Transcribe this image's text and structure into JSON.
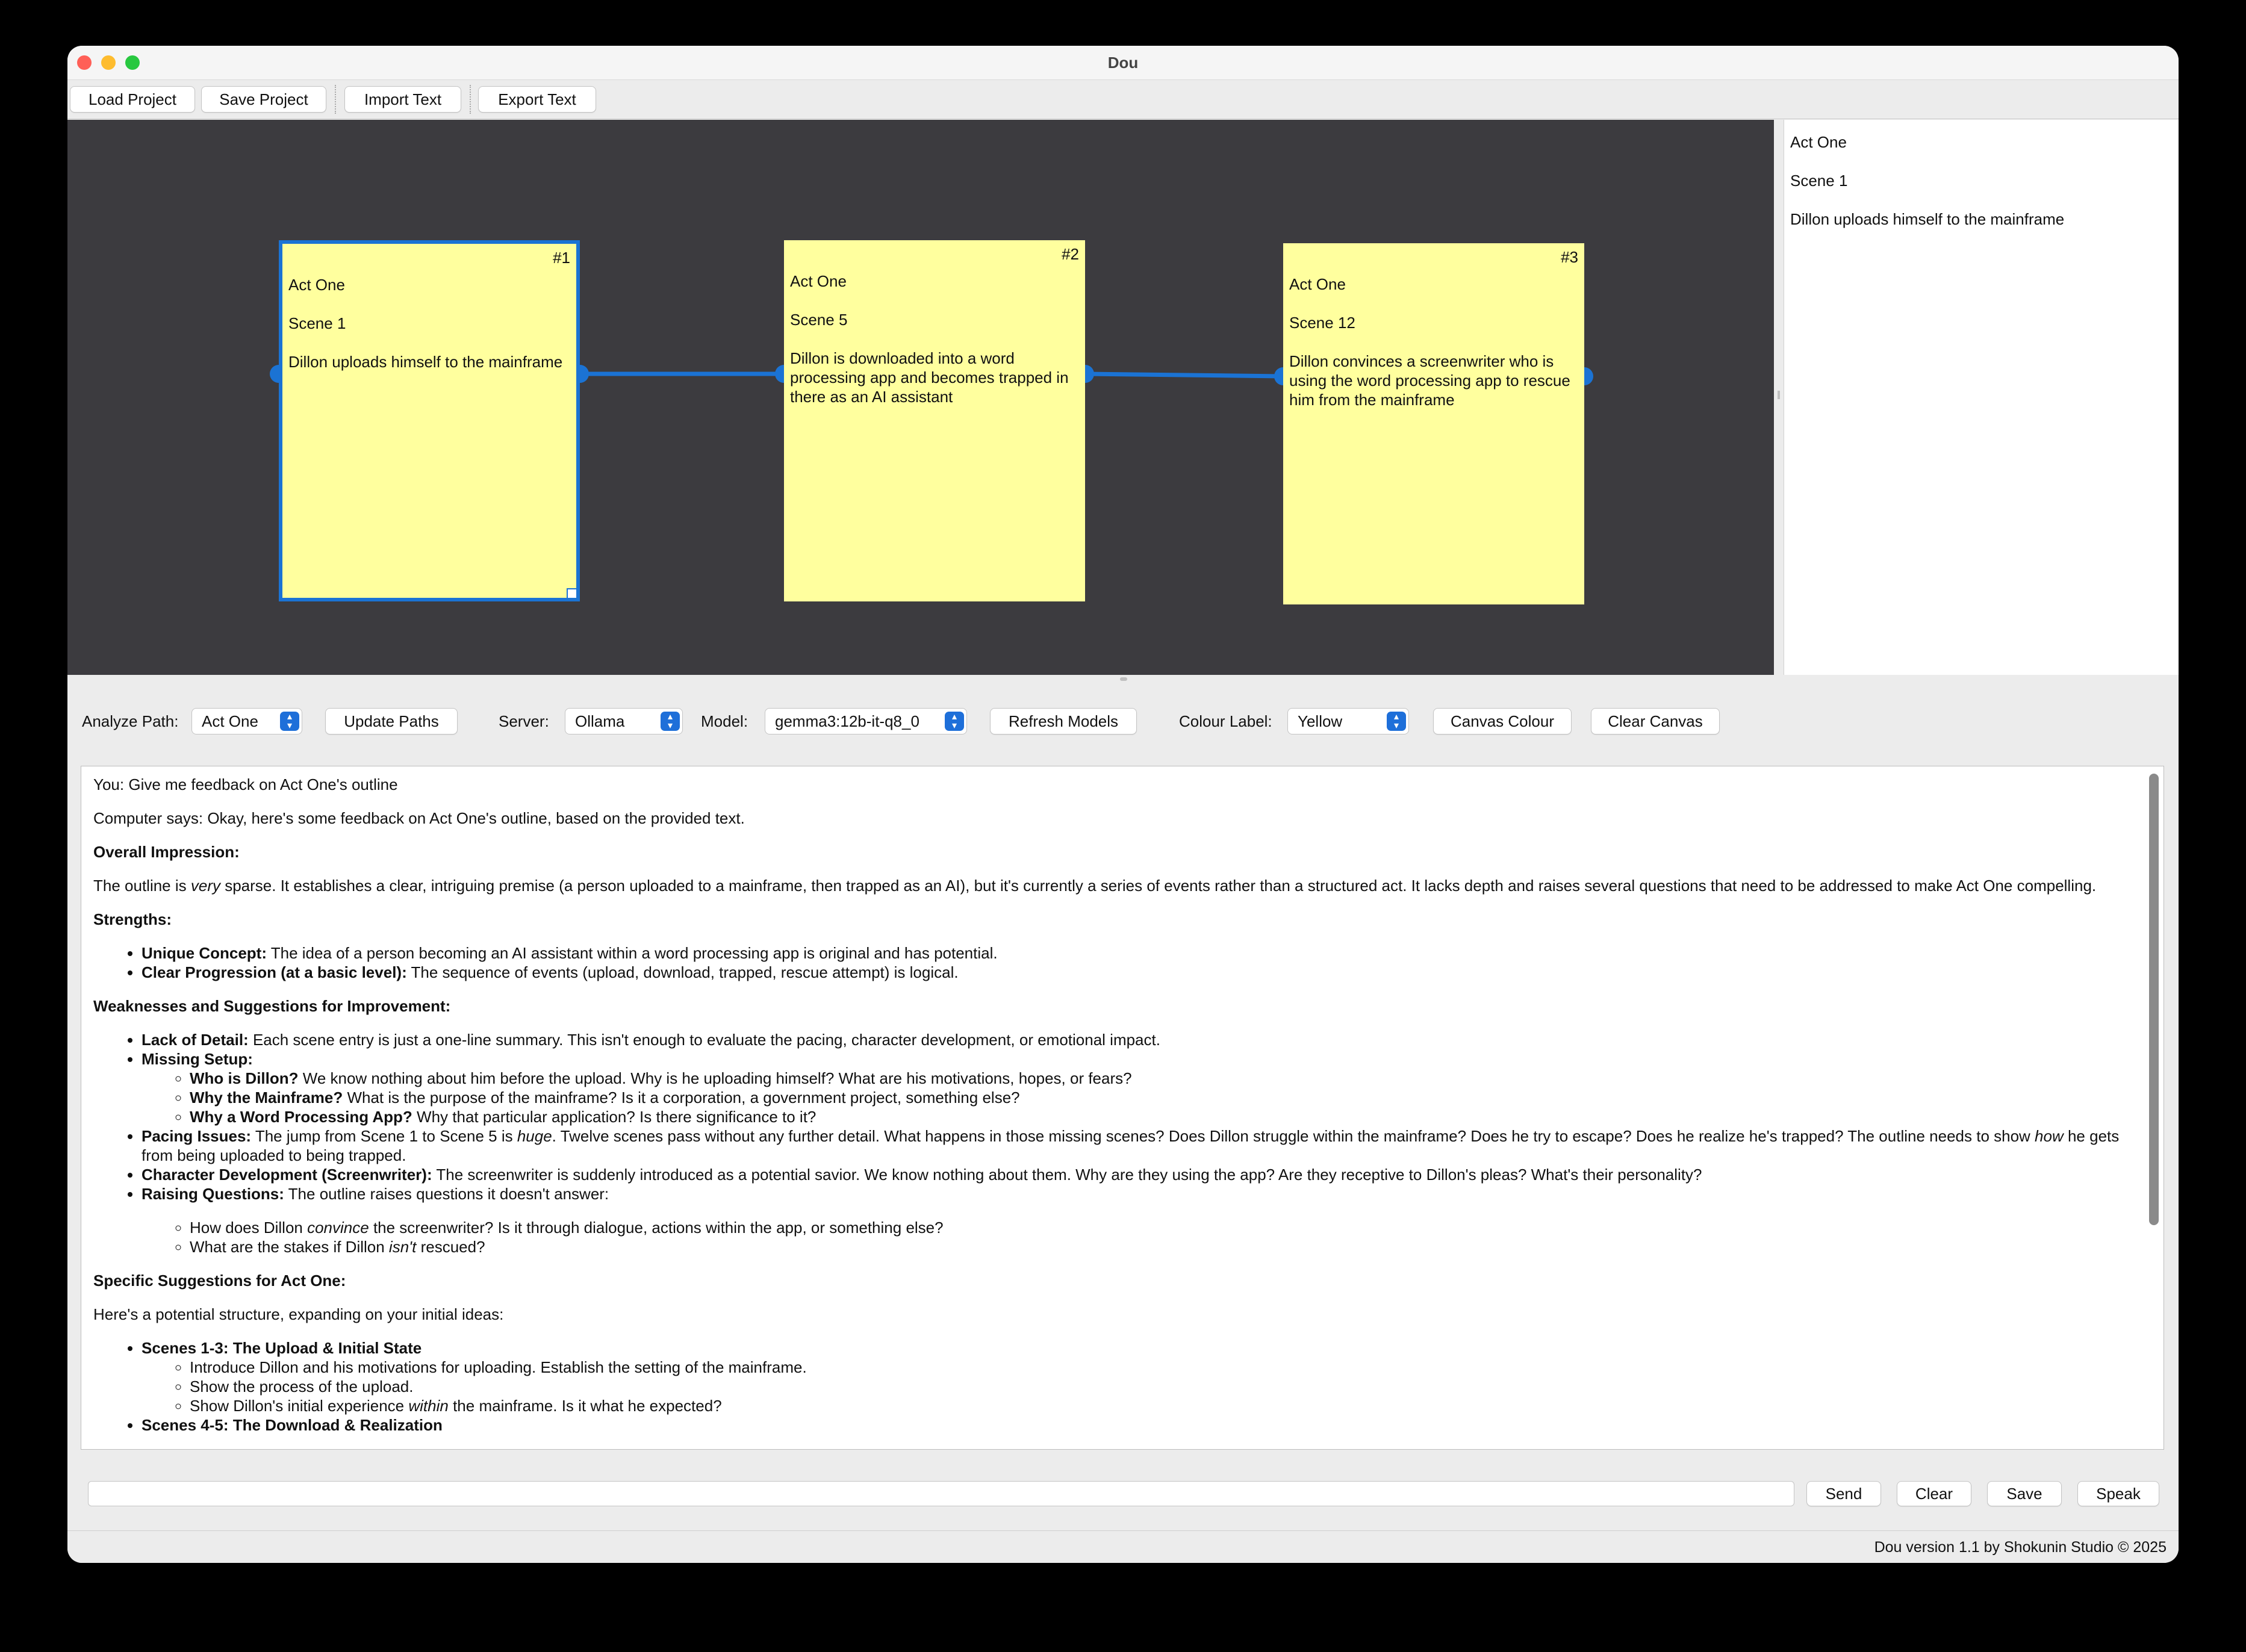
{
  "window": {
    "title": "Dou"
  },
  "toolbar": {
    "load_project": "Load Project",
    "save_project": "Save Project",
    "import_text": "Import Text",
    "export_text": "Export Text"
  },
  "cards": [
    {
      "number": "#1",
      "act": "Act One",
      "scene": "Scene 1",
      "description": "Dillon uploads himself to the mainframe",
      "selected": true
    },
    {
      "number": "#2",
      "act": "Act One",
      "scene": "Scene 5",
      "description": "Dillon is downloaded into a word processing app and becomes trapped in there as an AI assistant",
      "selected": false
    },
    {
      "number": "#3",
      "act": "Act One",
      "scene": "Scene 12",
      "description": "Dillon convinces a screenwriter who is using the word processing app to rescue him from the mainframe",
      "selected": false
    }
  ],
  "side_panel": {
    "lines": [
      "Act One",
      "Scene 1",
      "Dillon uploads himself to the mainframe"
    ]
  },
  "controls": {
    "analyze_path_label": "Analyze Path:",
    "analyze_path_value": "Act One",
    "update_paths": "Update Paths",
    "server_label": "Server:",
    "server_value": "Ollama",
    "model_label": "Model:",
    "model_value": "gemma3:12b-it-q8_0",
    "refresh_models": "Refresh Models",
    "colour_label_label": "Colour Label:",
    "colour_label_value": "Yellow",
    "canvas_colour": "Canvas Colour",
    "clear_canvas": "Clear Canvas"
  },
  "chat": {
    "you_prefix": "You:",
    "you_msg": "Give me feedback on Act One's outline",
    "computer_prefix": "Computer says:",
    "computer_intro": "Okay, here's some feedback on Act One's outline, based on the provided text.",
    "overall_heading": "Overall Impression:",
    "overall_a": "The outline is ",
    "overall_em": "very",
    "overall_b": " sparse. It establishes a clear, intriguing premise (a person uploaded to a mainframe, then trapped as an AI), but it's currently a series of events rather than a structured act. It lacks depth and raises several questions that need to be addressed to make Act One compelling.",
    "strengths_heading": "Strengths:",
    "s1_b": "Unique Concept:",
    "s1_t": " The idea of a person becoming an AI assistant within a word processing app is original and has potential.",
    "s2_b": "Clear Progression (at a basic level):",
    "s2_t": " The sequence of events (upload, download, trapped, rescue attempt) is logical.",
    "weak_heading": "Weaknesses and Suggestions for Improvement:",
    "w1_b": "Lack of Detail:",
    "w1_t": " Each scene entry is just a one-line summary. This isn't enough to evaluate the pacing, character development, or emotional impact.",
    "w2_b": "Missing Setup:",
    "w2a_b": "Who is Dillon?",
    "w2a_t": " We know nothing about him before the upload. Why is he uploading himself? What are his motivations, hopes, or fears?",
    "w2b_b": "Why the Mainframe?",
    "w2b_t": " What is the purpose of the mainframe? Is it a corporation, a government project, something else?",
    "w2c_b": "Why a Word Processing App?",
    "w2c_t": " Why that particular application? Is there significance to it?",
    "w3_b": "Pacing Issues:",
    "w3_t1": " The jump from Scene 1 to Scene 5 is ",
    "w3_em1": "huge",
    "w3_t2": ". Twelve scenes pass without any further detail. What happens in those missing scenes? Does Dillon struggle within the mainframe? Does he try to escape? Does he realize he's trapped? The outline needs to show ",
    "w3_em2": "how",
    "w3_t3": " he gets from being uploaded to being trapped.",
    "w4_b": "Character Development (Screenwriter):",
    "w4_t": " The screenwriter is suddenly introduced as a potential savior. We know nothing about them. Why are they using the app? Are they receptive to Dillon's pleas? What's their personality?",
    "w5_b": "Raising Questions:",
    "w5_t": " The outline raises questions it doesn't answer:",
    "q1_a": "How does Dillon ",
    "q1_em": "convince",
    "q1_b": " the screenwriter? Is it through dialogue, actions within the app, or something else?",
    "q2_a": "What are the stakes if Dillon ",
    "q2_em": "isn't",
    "q2_b": " rescued?",
    "specific_heading": "Specific Suggestions for Act One:",
    "specific_intro": "Here's a potential structure, expanding on your initial ideas:",
    "sc1_b": "Scenes 1-3: The Upload & Initial State",
    "sc1a": "Introduce Dillon and his motivations for uploading. Establish the setting of the mainframe.",
    "sc1b": "Show the process of the upload.",
    "sc1c_a": "Show Dillon's initial experience ",
    "sc1c_em": "within",
    "sc1c_b": " the mainframe. Is it what he expected?",
    "sc2_b": "Scenes 4-5: The Download & Realization"
  },
  "input": {
    "placeholder": "",
    "send": "Send",
    "clear": "Clear",
    "save": "Save",
    "speak": "Speak"
  },
  "status": {
    "text": "Dou version 1.1 by Shokunin Studio © 2025"
  },
  "colors": {
    "canvas_bg": "#3c3b3f",
    "card_bg": "#ffff9e",
    "accent": "#1b73d4"
  }
}
